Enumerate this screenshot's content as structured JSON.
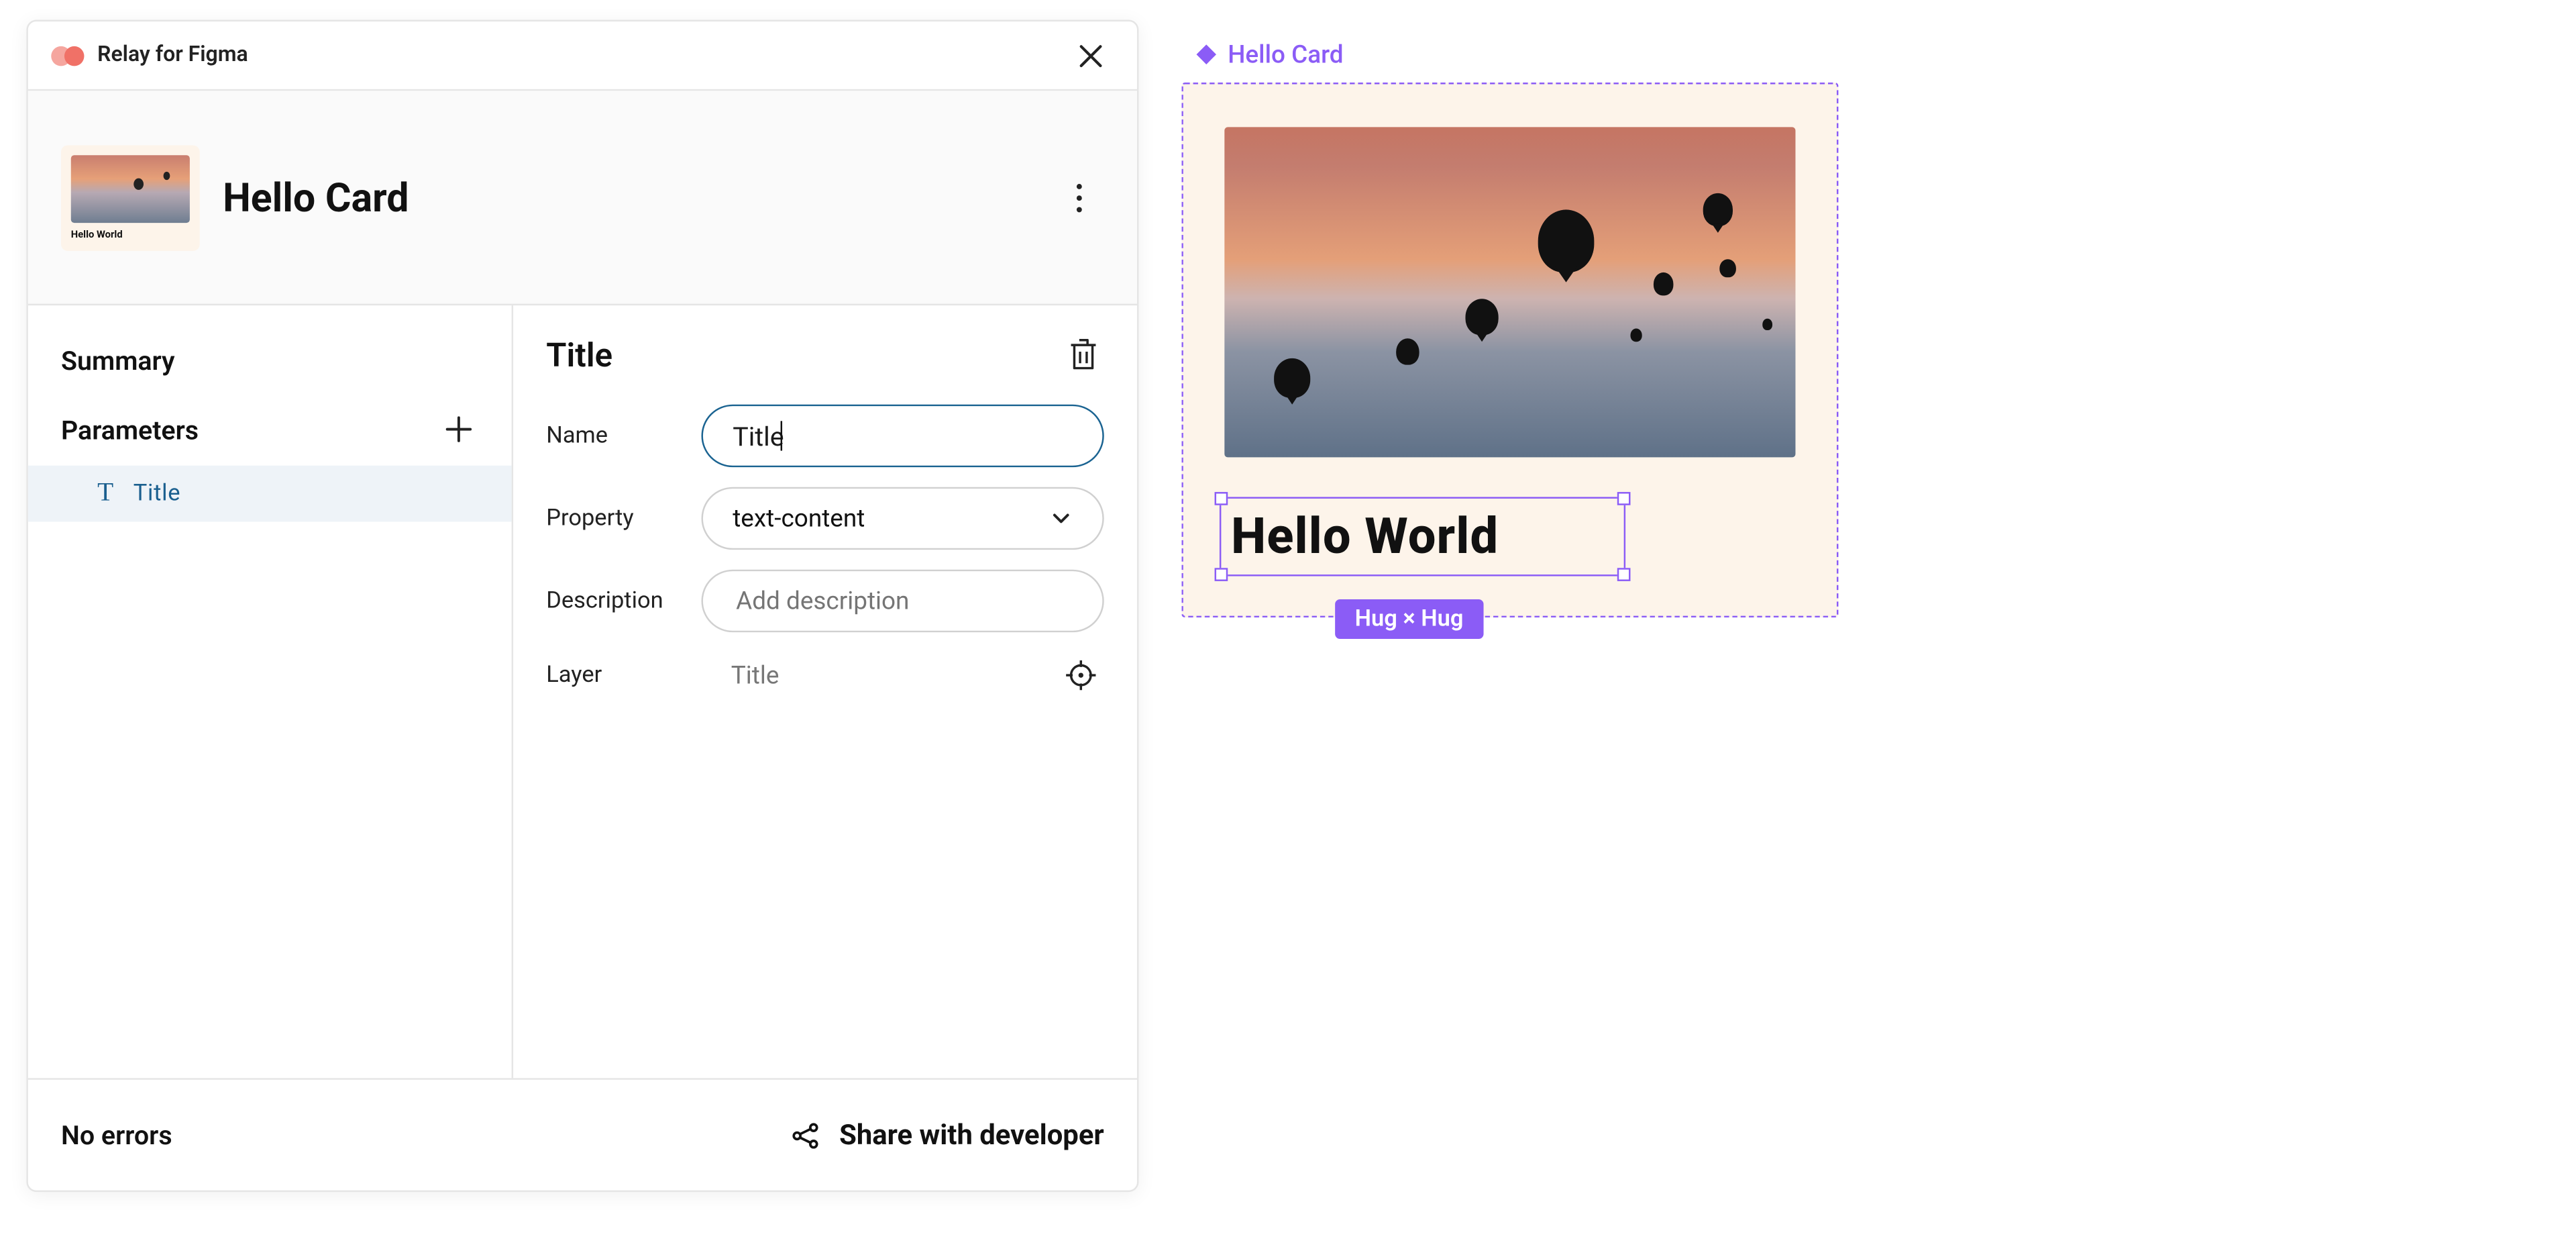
{
  "plugin": {
    "name": "Relay for Figma"
  },
  "component": {
    "name": "Hello Card",
    "thumb_caption": "Hello World"
  },
  "sidebar": {
    "summary_label": "Summary",
    "parameters_label": "Parameters",
    "params": [
      {
        "icon": "T",
        "name": "Title"
      }
    ]
  },
  "detail": {
    "heading": "Title",
    "name_label": "Name",
    "name_value": "Title",
    "property_label": "Property",
    "property_value": "text-content",
    "description_label": "Description",
    "description_placeholder": "Add description",
    "layer_label": "Layer",
    "layer_value": "Title"
  },
  "footer": {
    "errors": "No errors",
    "share": "Share with developer"
  },
  "canvas": {
    "frame_label": "Hello Card",
    "selected_text": "Hello World",
    "hug_badge": "Hug × Hug"
  }
}
